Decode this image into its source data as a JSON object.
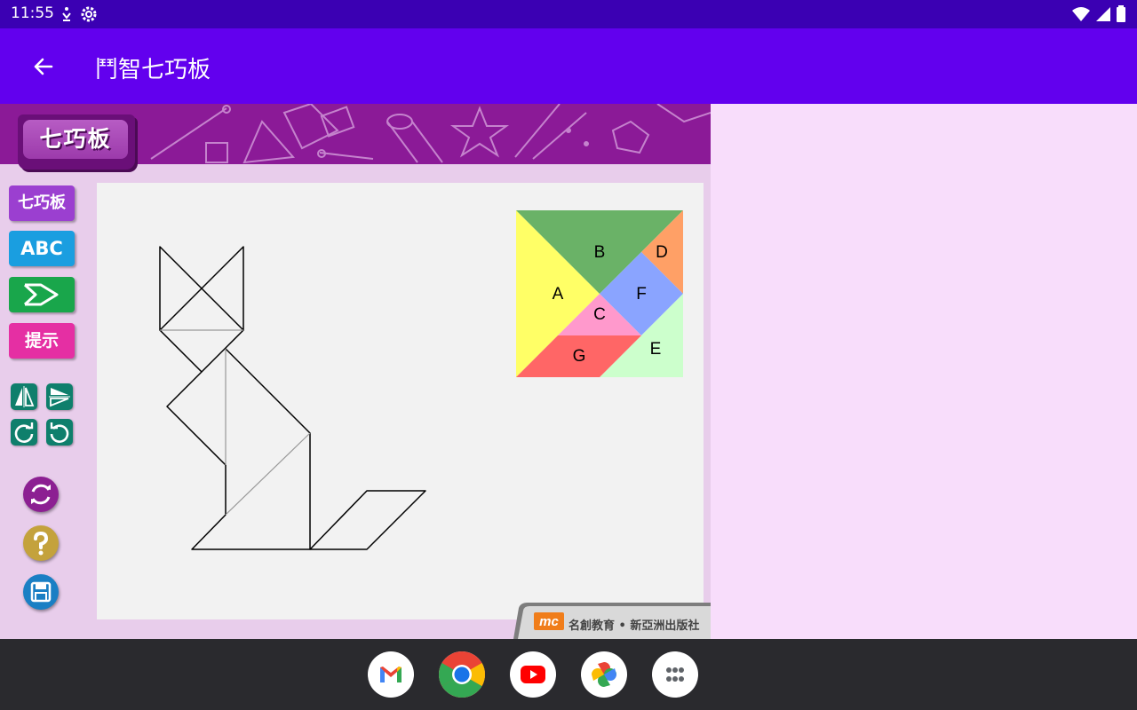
{
  "status_bar": {
    "time": "11:55",
    "left_icons": [
      "accessibility-download-icon",
      "settings-gear-icon"
    ],
    "right_icons": [
      "wifi-icon",
      "cellular-signal-icon",
      "battery-icon"
    ]
  },
  "app_bar": {
    "title": "鬥智七巧板",
    "back_icon": "arrow-back-icon"
  },
  "game": {
    "header_badge": "七巧板",
    "sidebar": {
      "tangram_label": "七巧板",
      "abc_label": "ABC",
      "fish_icon": "fish-outline-icon",
      "hint_label": "提示"
    },
    "tools": [
      "flip-horizontal-icon",
      "flip-vertical-icon",
      "rotate-clockwise-icon",
      "rotate-counterclockwise-icon"
    ],
    "actions": [
      "reset-icon",
      "help-icon",
      "save-icon"
    ],
    "pieces": [
      {
        "label": "A",
        "color": "#ffff66"
      },
      {
        "label": "B",
        "color": "#6ab267"
      },
      {
        "label": "C",
        "color": "#ff99cc"
      },
      {
        "label": "D",
        "color": "#ffa066"
      },
      {
        "label": "E",
        "color": "#ccffcc"
      },
      {
        "label": "F",
        "color": "#8aa4ff"
      },
      {
        "label": "G",
        "color": "#ff6666"
      }
    ],
    "publisher_logo": "mc",
    "publisher": "名創教育 • 新亞洲出版社"
  },
  "dock": [
    "gmail-icon",
    "chrome-icon",
    "youtube-icon",
    "photos-icon",
    "app-drawer-icon"
  ]
}
